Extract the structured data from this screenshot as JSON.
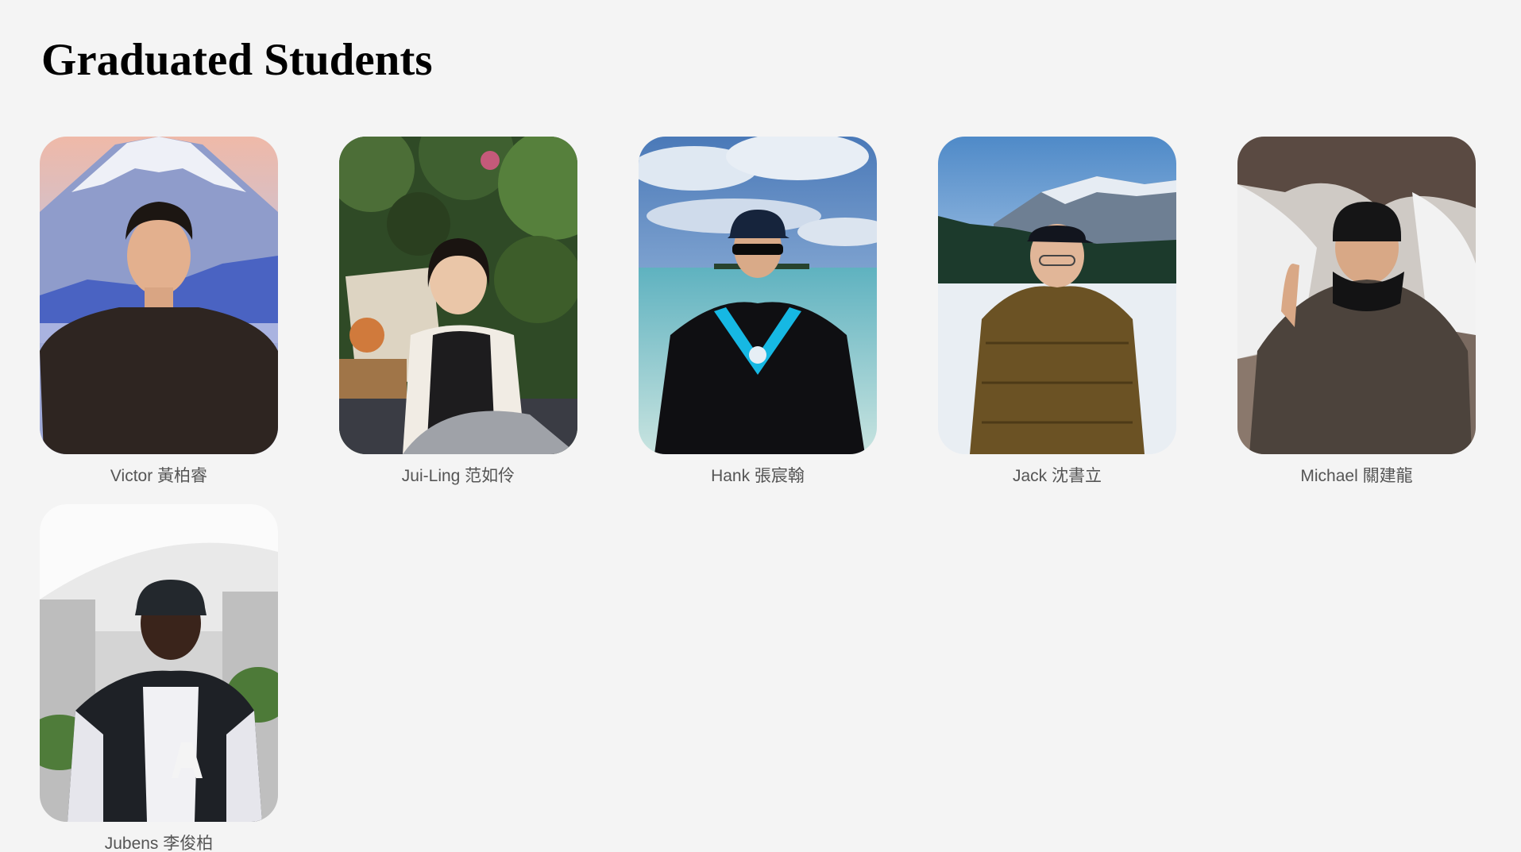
{
  "page": {
    "title": "Graduated Students"
  },
  "students": [
    {
      "name": "Victor 黃柏睿"
    },
    {
      "name": "Jui-Ling 范如伶"
    },
    {
      "name": "Hank 張宸翰"
    },
    {
      "name": "Jack 沈書立"
    },
    {
      "name": "Michael 關建龍"
    },
    {
      "name": "Jubens 李俊柏"
    }
  ]
}
